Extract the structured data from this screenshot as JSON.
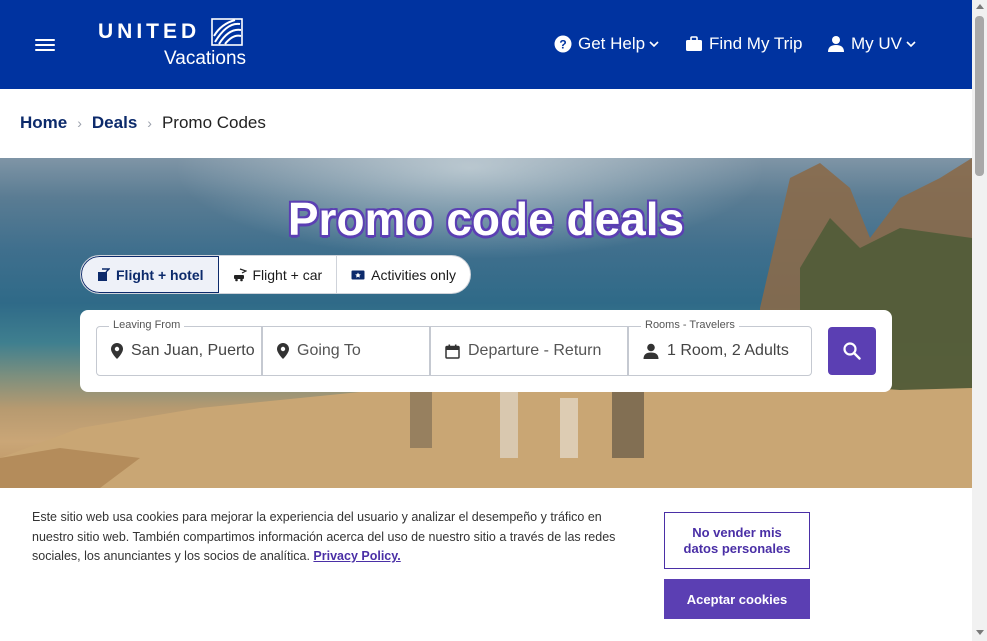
{
  "header": {
    "logo_word": "UNITED",
    "logo_sub": "Vacations",
    "nav": {
      "help": "Get Help",
      "trip": "Find My Trip",
      "account": "My UV"
    }
  },
  "breadcrumb": {
    "home": "Home",
    "deals": "Deals",
    "current": "Promo Codes"
  },
  "hero": {
    "title": "Promo code deals",
    "tabs": [
      "Flight + hotel",
      "Flight + car",
      "Activities only"
    ],
    "active_tab": "Flight + hotel"
  },
  "search": {
    "leaving_label": "Leaving From",
    "leaving_value": "San Juan, Puerto",
    "going_placeholder": "Going To",
    "dates_placeholder": "Departure - Return",
    "rooms_label": "Rooms - Travelers",
    "rooms_value": "1 Room, 2 Adults"
  },
  "cookie": {
    "text": "Este sitio web usa cookies para mejorar la experiencia del usuario y analizar el desempeño y tráfico en nuestro sitio web. También compartimos información acerca del uso de nuestro sitio a través de las redes sociales, los anunciantes y los socios de analítica.",
    "link": "Privacy Policy.",
    "btn_no_sell": "No vender mis datos personales",
    "btn_accept": "Aceptar cookies"
  },
  "colors": {
    "header_bg": "#0033a0",
    "accent": "#5b3fb3",
    "link": "#0c2a6b"
  }
}
